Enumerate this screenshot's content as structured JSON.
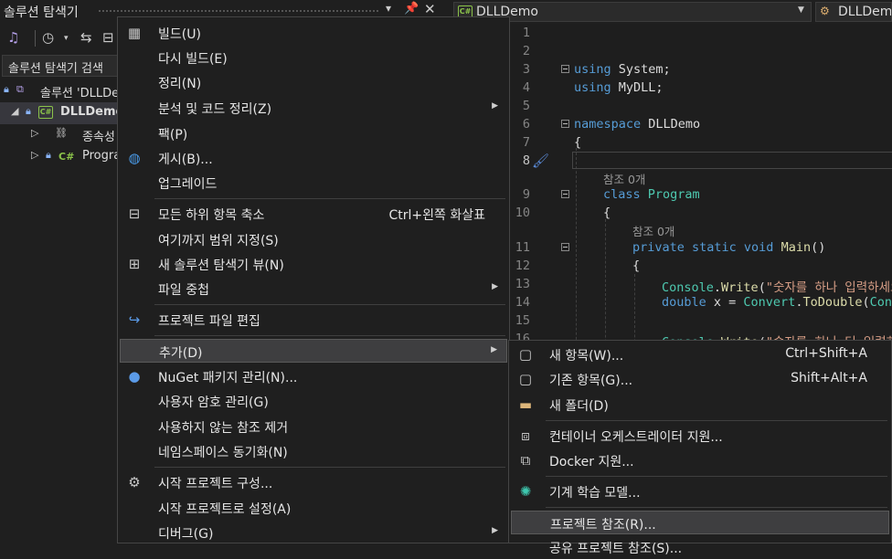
{
  "solution_explorer": {
    "title": "솔루션 탐색기",
    "search_text": "솔루션 탐색기 검색",
    "solution_label": "솔루션 'DLLDemo'",
    "project_label": "DLLDemo",
    "dependencies_label": "종속성",
    "program_label": "Program.cs"
  },
  "editor_nav": {
    "project_combo": "DLLDemo",
    "class_combo": "DLLDemo.Program"
  },
  "editor": {
    "line_numbers": [
      "1",
      "2",
      "3",
      "4",
      "5",
      "6",
      "7",
      "8",
      "9",
      "10",
      "11",
      "12",
      "13",
      "14",
      "15",
      "16"
    ],
    "ref_count_class": "참조 0개",
    "ref_count_main": "참조 0개",
    "code": {
      "l3_kw": "using",
      "l3_rest": " System;",
      "l4_kw": "using",
      "l4_rest": " MyDLL;",
      "l6_kw": "namespace",
      "l6_rest": " DLLDemo",
      "l7": "{",
      "l9_kw": "class",
      "l9_ty": " Program",
      "l10": "{",
      "l11_kw": "private static void",
      "l11_fn": " Main",
      "l11_rest": "()",
      "l12": "{",
      "l13_ty": "Console",
      "l13_mid": ".",
      "l13_fn": "Write",
      "l13_p": "(",
      "l13_str": "\"숫자를 하나 입력하세요\"",
      "l14_kw": "double",
      "l14_mid": " x = ",
      "l14_ty": "Convert",
      "l14_dot": ".",
      "l14_fn": "ToDouble",
      "l14_p": "(",
      "l14_ty2": "Console",
      "l16_ty": "Console",
      "l16_mid": ".",
      "l16_fn": "Write",
      "l16_p": "(",
      "l16_str": "\"숫자를 하나 더 입력하세요\""
    }
  },
  "context_menu": {
    "items": [
      {
        "label": "빌드(U)",
        "icon": "build-icon"
      },
      {
        "label": "다시 빌드(E)"
      },
      {
        "label": "정리(N)"
      },
      {
        "label": "분석 및 코드 정리(Z)",
        "submenu": true
      },
      {
        "label": "팩(P)"
      },
      {
        "label": "게시(B)...",
        "icon": "globe-icon"
      },
      {
        "label": "업그레이드"
      },
      {
        "label": "모든 하위 항목 축소",
        "shortcut": "Ctrl+왼쪽 화살표",
        "icon": "collapse-icon"
      },
      {
        "label": "여기까지 범위 지정(S)"
      },
      {
        "label": "새 솔루션 탐색기 뷰(N)",
        "icon": "new-view-icon"
      },
      {
        "label": "파일 중첩",
        "submenu": true
      },
      {
        "label": "프로젝트 파일 편집",
        "icon": "edit-project-icon"
      },
      {
        "label": "추가(D)",
        "submenu": true
      },
      {
        "label": "NuGet 패키지 관리(N)...",
        "icon": "nuget-icon"
      },
      {
        "label": "사용자 암호 관리(G)"
      },
      {
        "label": "사용하지 않는 참조 제거"
      },
      {
        "label": "네임스페이스 동기화(N)"
      },
      {
        "label": "시작 프로젝트 구성...",
        "icon": "gear-icon"
      },
      {
        "label": "시작 프로젝트로 설정(A)"
      },
      {
        "label": "디버그(G)",
        "submenu": true
      }
    ]
  },
  "add_submenu": {
    "items": [
      {
        "label": "새 항목(W)...",
        "shortcut": "Ctrl+Shift+A",
        "icon": "new-item-icon"
      },
      {
        "label": "기존 항목(G)...",
        "shortcut": "Shift+Alt+A",
        "icon": "existing-item-icon"
      },
      {
        "label": "새 폴더(D)",
        "icon": "new-folder-icon"
      },
      {
        "label": "컨테이너 오케스트레이터 지원...",
        "icon": "container-icon"
      },
      {
        "label": "Docker 지원...",
        "icon": "docker-icon"
      },
      {
        "label": "기계 학습 모델...",
        "icon": "ml-icon"
      },
      {
        "label": "프로젝트 참조(R)..."
      },
      {
        "label": "공유 프로젝트 참조(S)..."
      }
    ]
  }
}
